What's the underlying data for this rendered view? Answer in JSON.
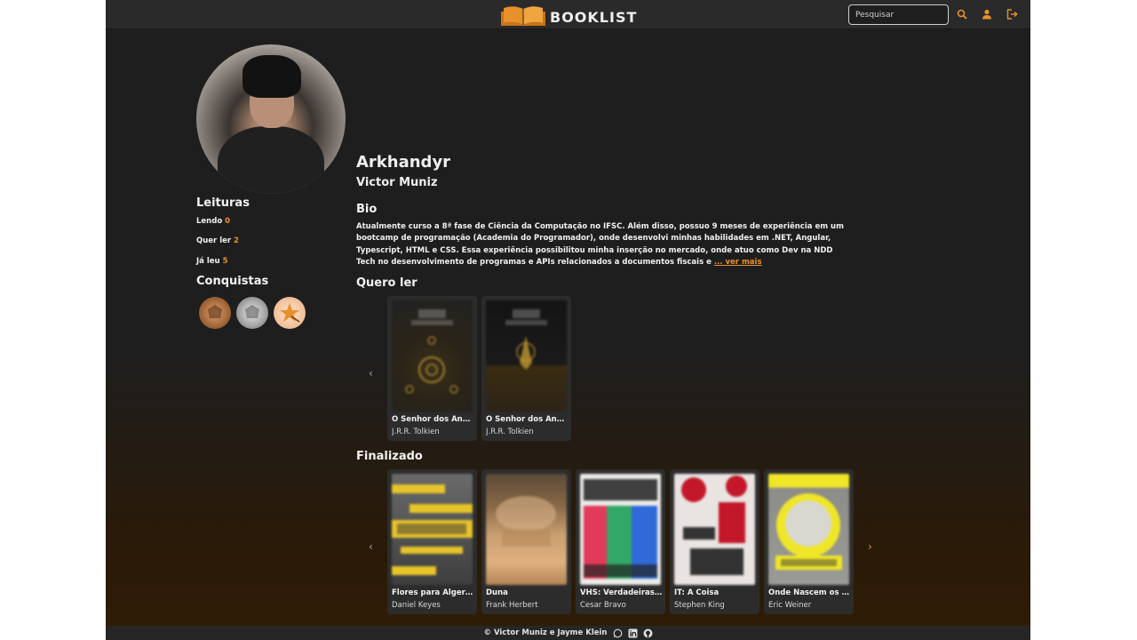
{
  "header": {
    "logo_text": "BOOKLIST",
    "search_placeholder": "Pesquisar",
    "icons": [
      "search-icon",
      "user-icon",
      "logout-icon"
    ],
    "accent_color": "#e8902a"
  },
  "profile": {
    "username": "Arkhandyr",
    "real_name": "Victor Muniz",
    "bio_title": "Bio",
    "bio_text": "Atualmente curso a 8ª fase de Ciência da Computação no IFSC. Além disso, possuo 9 meses de experiência em um bootcamp de programação (Academia do Programador), onde desenvolvi minhas habilidades em .NET, Angular, Typescript, HTML e CSS. Essa experiência possibilitou minha inserção no mercado, onde atuo como Dev na NDD Tech no desenvolvimento de programas e APIs relacionados a documentos fiscais e",
    "see_more": "... ver mais"
  },
  "readings": {
    "title": "Leituras",
    "reading_label": "Lendo",
    "reading_count": "0",
    "want_label": "Quer ler",
    "want_count": "2",
    "read_label": "Já leu",
    "read_count": "5"
  },
  "achievements": {
    "title": "Conquistas",
    "badges": [
      "bronze-badge",
      "silver-badge",
      "star-badge"
    ]
  },
  "want_to_read": {
    "title": "Quero ler",
    "books": [
      {
        "title": "O Senhor dos Anéis...",
        "author": "J.R.R. Tolkien"
      },
      {
        "title": "O Senhor dos Anéis...",
        "author": "J.R.R. Tolkien"
      }
    ]
  },
  "finished": {
    "title": "Finalizado",
    "books": [
      {
        "title": "Flores para Algernon",
        "author": "Daniel Keyes"
      },
      {
        "title": "Duna",
        "author": "Frank Herbert"
      },
      {
        "title": "VHS: Verdadeiras H...",
        "author": "Cesar Bravo"
      },
      {
        "title": "IT: A Coisa",
        "author": "Stephen King"
      },
      {
        "title": "Onde Nascem os G...",
        "author": "Eric Weiner"
      }
    ]
  },
  "footer": {
    "credit": "© Victor Muniz e Jayme Klein",
    "icons": [
      "whatsapp-icon",
      "linkedin-icon",
      "github-icon"
    ]
  }
}
